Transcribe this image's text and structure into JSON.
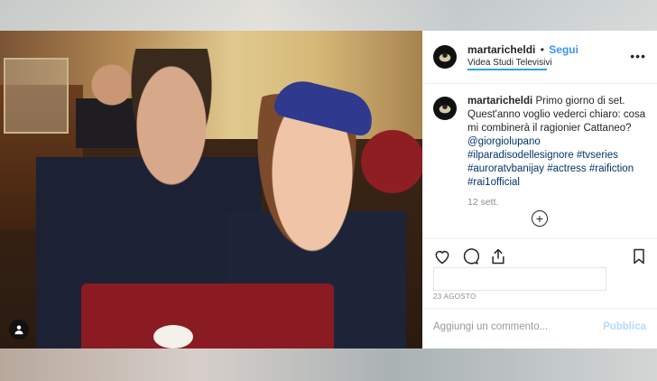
{
  "post": {
    "username": "martaricheldi",
    "separator": "•",
    "follow_label": "Segui",
    "location": "Videa Studi Televisivi",
    "more_label": "•••",
    "caption": {
      "username": "martaricheldi",
      "text_1": "Primo giorno di set. Quest'anno voglio vederci chiaro: cosa mi combinerà il ragionier Cattaneo?",
      "mention": "@giorgiolupano",
      "hashtags_line_1": "#ilparadisodellesignore #tvseries",
      "hashtags_line_2": "#auroratvbanijay #actress #raifiction",
      "hashtags_line_3": "#rai1official",
      "date": "12 sett."
    },
    "posted_label": "23 AGOSTO",
    "comment_placeholder": "Aggiungi un commento...",
    "publish_label": "Pubblica"
  },
  "colors": {
    "link_blue": "#3897f0",
    "hashtag_blue": "#003569",
    "location_underline": "#27a7e0"
  },
  "icons": [
    "user-tag-icon",
    "avatar-icon",
    "more-icon",
    "load-more-icon",
    "heart-icon",
    "comment-icon",
    "share-icon",
    "bookmark-icon"
  ]
}
